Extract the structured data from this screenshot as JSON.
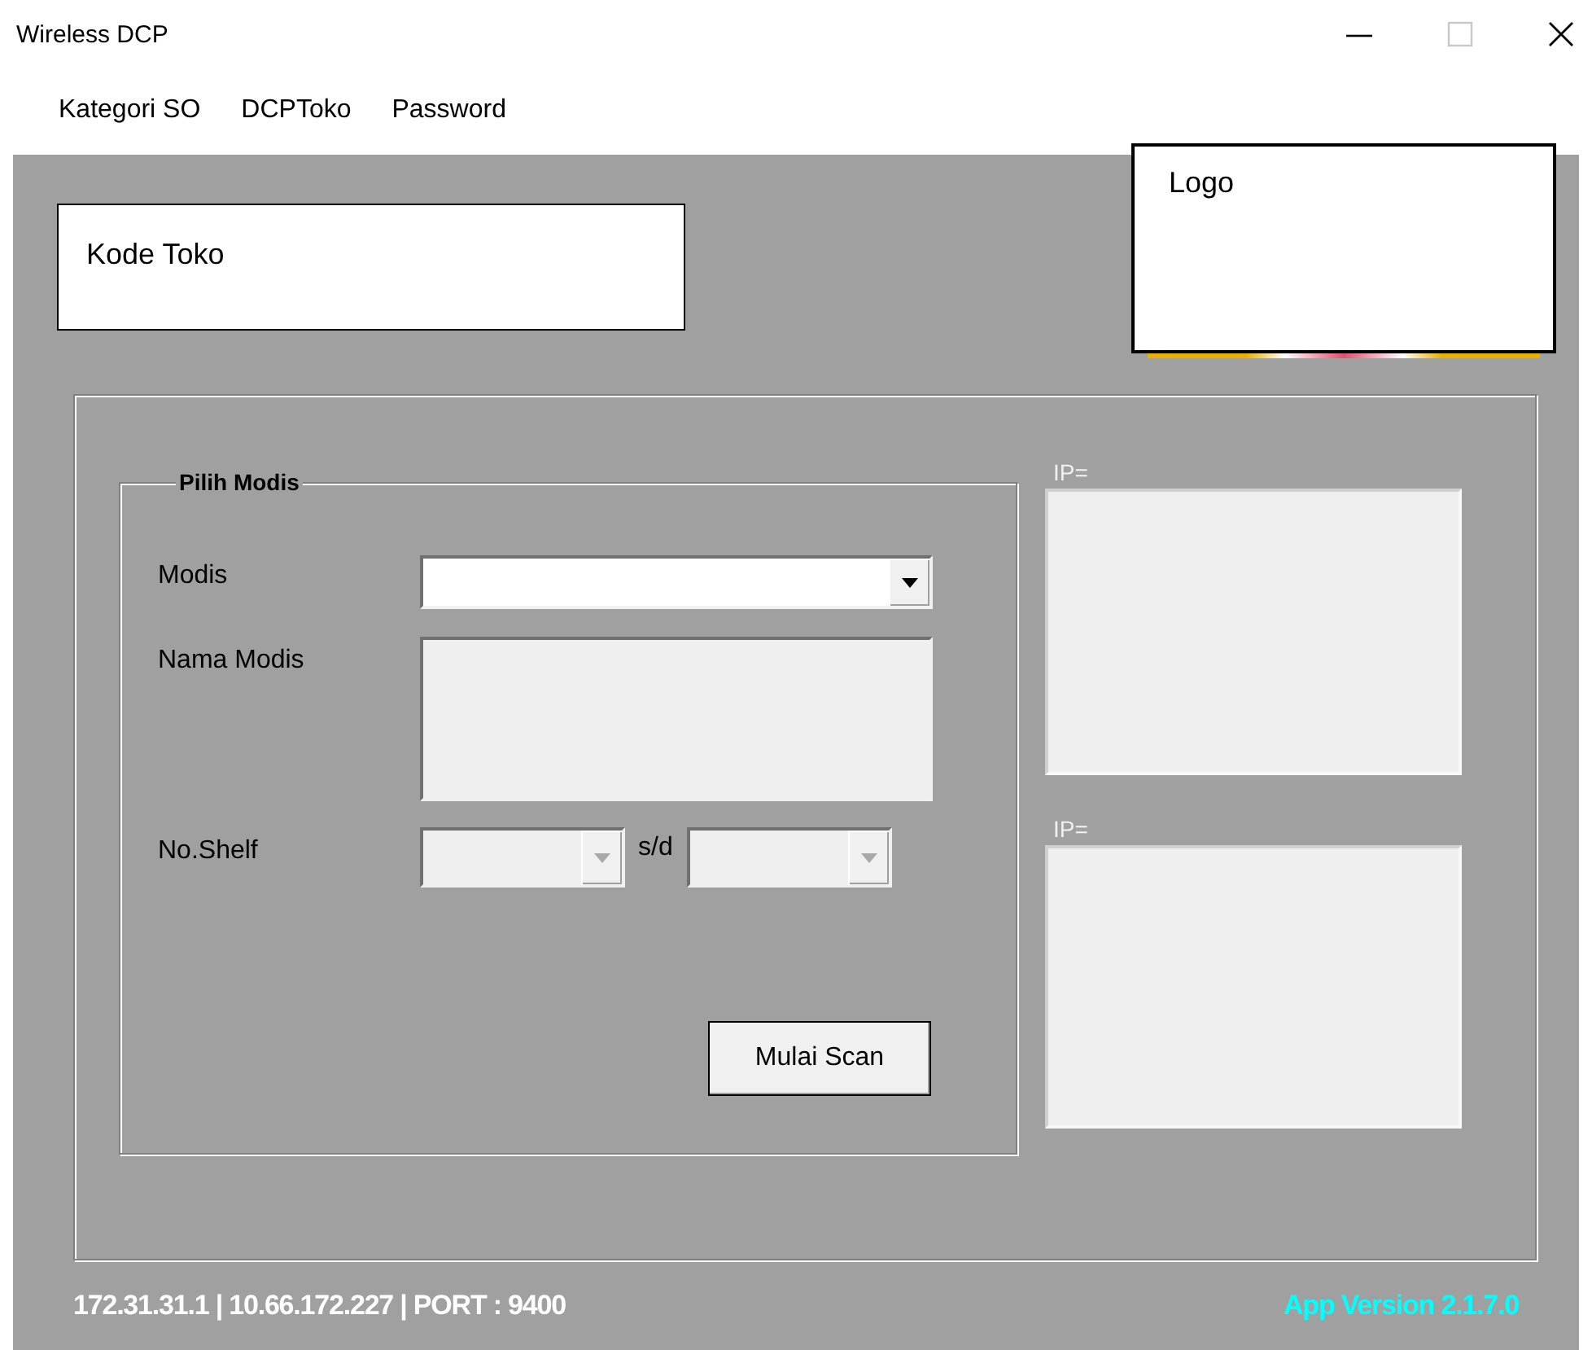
{
  "window": {
    "title": "Wireless DCP",
    "maximize_disabled": true
  },
  "menu": [
    "Kategori SO",
    "DCPToko",
    "Password"
  ],
  "store_code": {
    "label": "Kode Toko"
  },
  "logo": {
    "label": "Logo"
  },
  "group": {
    "title": "Pilih Modis",
    "modis": {
      "label": "Modis",
      "disabled": false
    },
    "nama_modis": {
      "label": "Nama Modis"
    },
    "shelf": {
      "label": "No.Shelf",
      "separator": "s/d",
      "from_disabled": true,
      "to_disabled": true
    },
    "scan_button": "Mulai Scan"
  },
  "ip_panels": [
    {
      "label": "IP="
    },
    {
      "label": "IP="
    }
  ],
  "status_bar": {
    "connection": "172.31.31.1 | 10.66.172.227 | PORT : 9400",
    "version": "App Version 2.1.7.0"
  }
}
